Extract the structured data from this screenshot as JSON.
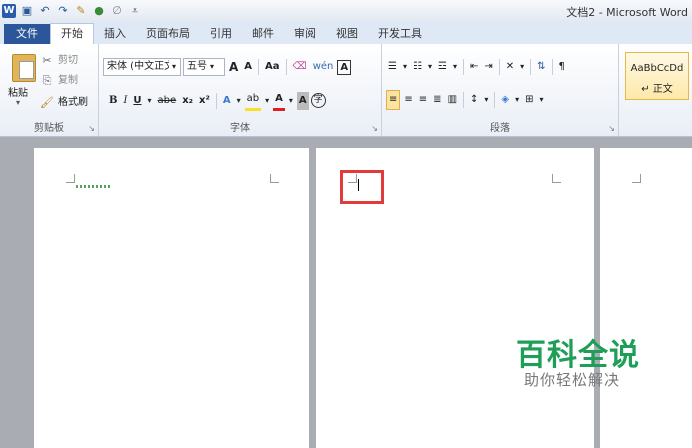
{
  "window": {
    "title": "文档2 - Microsoft Word"
  },
  "quick_access": {
    "icons": [
      "word-logo",
      "save-icon",
      "undo-icon",
      "redo-icon",
      "format-painter-icon",
      "color-icon",
      "eraser-icon",
      "customize-icon"
    ]
  },
  "tabs": [
    {
      "label": "文件"
    },
    {
      "label": "开始"
    },
    {
      "label": "插入"
    },
    {
      "label": "页面布局"
    },
    {
      "label": "引用"
    },
    {
      "label": "邮件"
    },
    {
      "label": "审阅"
    },
    {
      "label": "视图"
    },
    {
      "label": "开发工具"
    }
  ],
  "active_tab": "开始",
  "clipboard": {
    "paste_label": "粘贴",
    "cut_label": "剪切",
    "copy_label": "复制",
    "format_painter_label": "格式刷",
    "group_label": "剪贴板"
  },
  "font": {
    "font_name": "宋体 (中文正文",
    "font_size": "五号",
    "group_label": "字体",
    "grow_label": "A",
    "shrink_label": "A",
    "case_label": "Aa",
    "phonetic_label": "wén",
    "border_label": "A",
    "bold_label": "B",
    "italic_label": "I",
    "underline_label": "U",
    "strike_label": "abe",
    "subscript_label": "x₂",
    "superscript_label": "x²",
    "effects_label": "A",
    "highlight_label": "ab",
    "color_label": "A",
    "shading_label": "A",
    "enclose_label": "字"
  },
  "paragraph": {
    "group_label": "段落"
  },
  "styles": {
    "preview": "AaBbCcDd",
    "name": "↵ 正文"
  },
  "watermark": {
    "title": "百科全说",
    "subtitle": "助你轻松解决"
  },
  "colors": {
    "file_tab": "#2b579a",
    "highlight_box": "#e03a3a",
    "watermark": "#1e9e57"
  }
}
